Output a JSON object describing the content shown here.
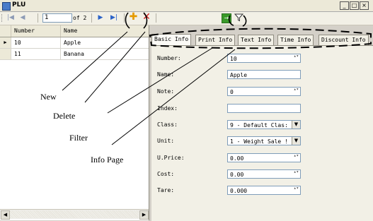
{
  "window": {
    "title": "PLU",
    "minimize_glyph": "_",
    "maximize_glyph": "□",
    "close_glyph": "×"
  },
  "toolbar": {
    "position_value": "1",
    "of_label": "of 2",
    "icons": [
      "move-first-icon",
      "move-previous-icon",
      "move-next-icon",
      "move-last-icon",
      "add-icon",
      "delete-icon",
      "go-icon",
      "filter-icon"
    ],
    "first_glyph": "|◀",
    "prev_glyph": "◀",
    "next_glyph": "▶",
    "last_glyph": "▶|",
    "add_glyph": "✚",
    "delete_glyph": "✕",
    "go_glyph": "→"
  },
  "grid": {
    "columns": [
      "Number",
      "Name"
    ],
    "rows": [
      {
        "indicator": "▶",
        "number": "10",
        "name": "Apple"
      },
      {
        "indicator": "",
        "number": "11",
        "name": "Banana"
      }
    ],
    "scroll_left": "◀",
    "scroll_right": "▶"
  },
  "tabs": [
    "Basic Info",
    "Print Info",
    "Text Info",
    "Time Info",
    "Discount Info"
  ],
  "form": {
    "number_label": "Number:",
    "number_value": "10",
    "name_label": "Name:",
    "name_value": "Apple",
    "note_label": "Note:",
    "note_value": "0",
    "index_label": "Index:",
    "index_value": "",
    "class_label": "Class:",
    "class_value": "9 - Default Clas:",
    "unit_label": "Unit:",
    "unit_value": "1 - Weight Sale !",
    "uprice_label": "U.Price:",
    "uprice_value": "0.00",
    "cost_label": "Cost:",
    "cost_value": "0.00",
    "tare_label": "Tare:",
    "tare_value": "0.000",
    "spin_glyph": "▴▾",
    "dropdown_glyph": "▼"
  },
  "annotations": {
    "new": "New",
    "delete": "Delete",
    "filter": "Filter",
    "info_page": "Info Page"
  },
  "colors": {
    "annotation_ink": "#000000",
    "delete_red": "#d42222",
    "add_orange": "#e59a00",
    "nav_blue": "#2a62c8"
  }
}
